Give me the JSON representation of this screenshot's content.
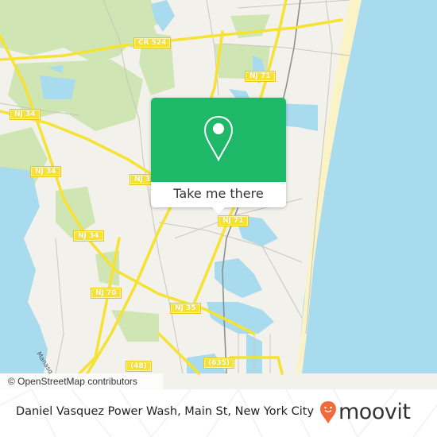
{
  "map": {
    "road_labels": [
      {
        "id": "cr524",
        "text": "CR 524"
      },
      {
        "id": "nj71-top",
        "text": "NJ 71"
      },
      {
        "id": "nj34-a",
        "text": "NJ 34"
      },
      {
        "id": "nj34-b",
        "text": "NJ 34"
      },
      {
        "id": "nj3x",
        "text": "NJ 3"
      },
      {
        "id": "nj34-c",
        "text": "NJ 34"
      },
      {
        "id": "nj71-mid",
        "text": "NJ 71"
      },
      {
        "id": "nj70",
        "text": "NJ 70"
      },
      {
        "id": "nj35",
        "text": "NJ 35"
      },
      {
        "id": "cr48",
        "text": "(48)"
      },
      {
        "id": "cr635",
        "text": "(635)"
      }
    ],
    "water_label": "Manasq",
    "attribution": "© OpenStreetMap contributors",
    "colors": {
      "land": "#f2f1ec",
      "park": "#cfe5b3",
      "water": "#a8dbee",
      "road_major": "#f6e233",
      "beach": "#faf3c8"
    }
  },
  "popup": {
    "cta_label": "Take me there",
    "icon": "map-pin-icon",
    "color": "#1db868"
  },
  "footer": {
    "caption": "Daniel Vasquez Power Wash, Main St, New York City",
    "brand": "moovit",
    "brand_color": "#f26a3a"
  }
}
